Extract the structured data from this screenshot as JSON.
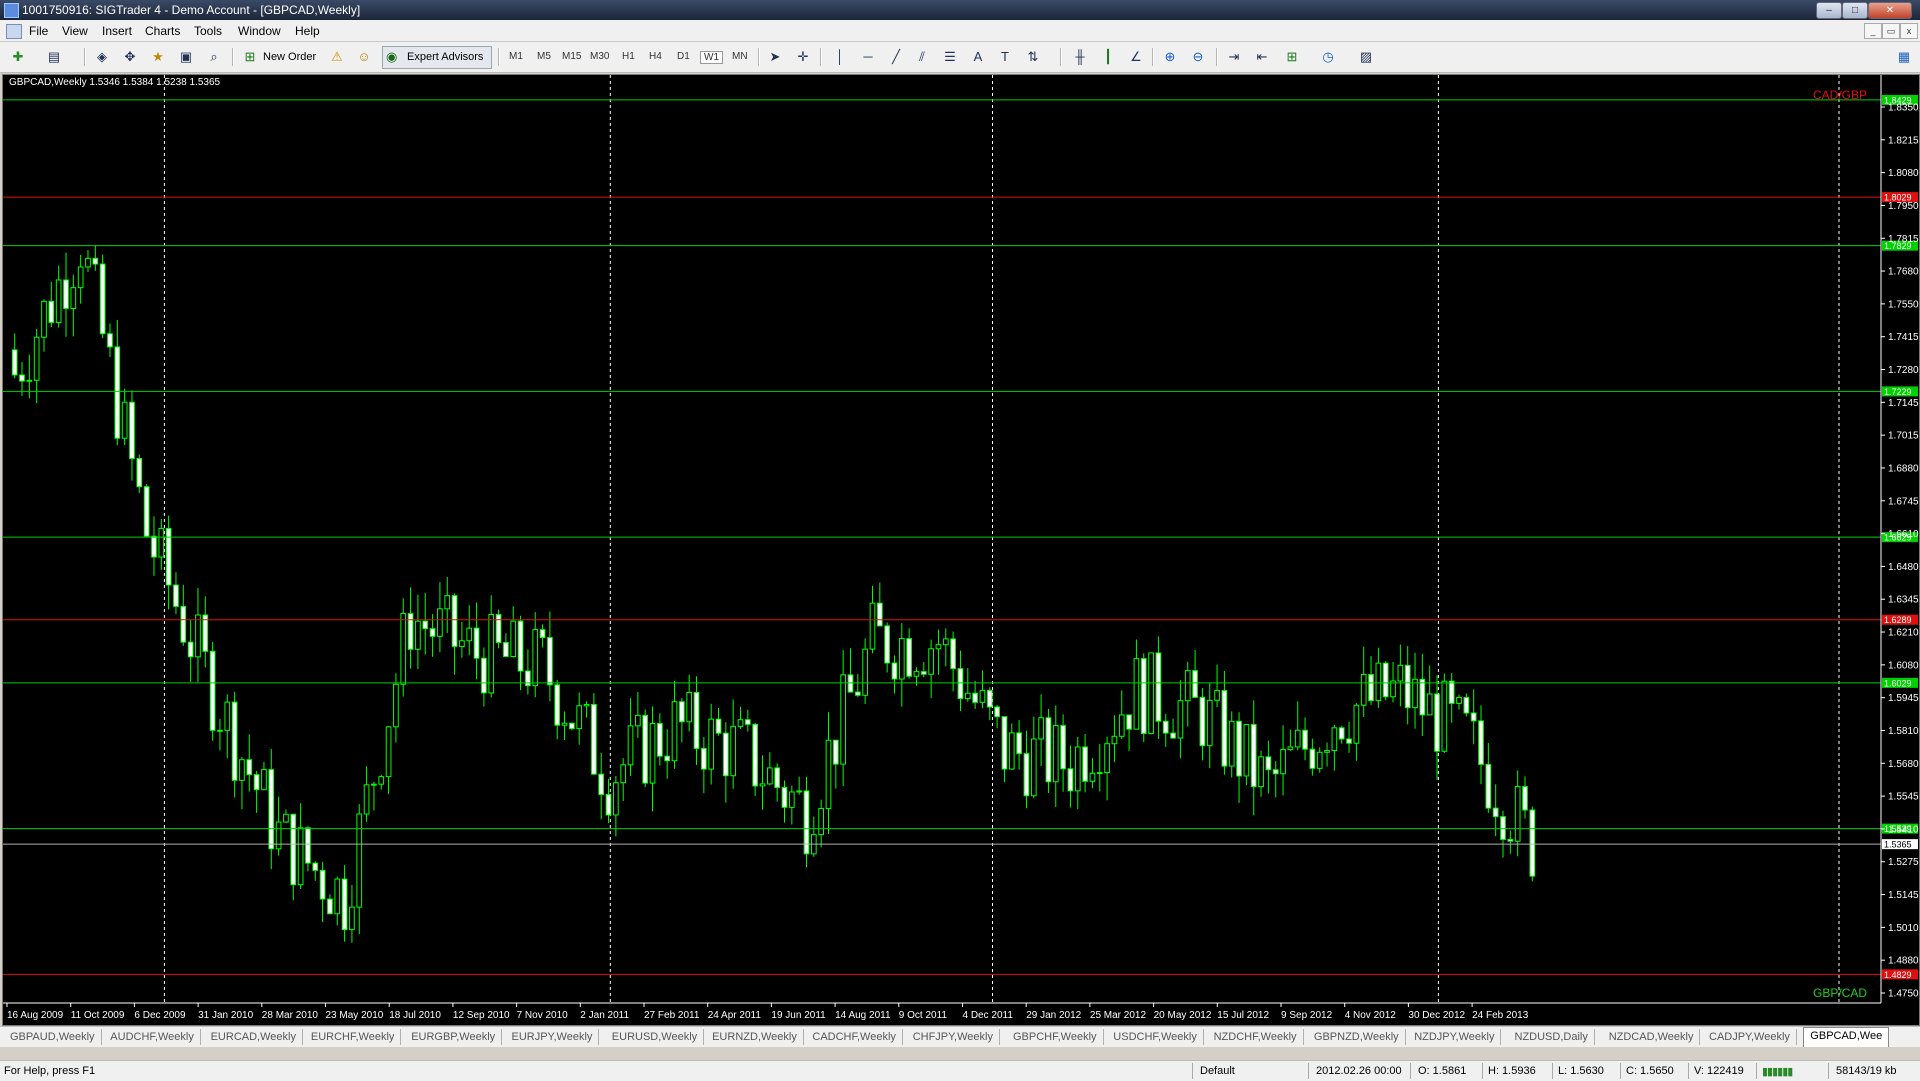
{
  "window": {
    "title": "1001750916: SIGTrader 4 - Demo Account - [GBPCAD,Weekly]",
    "min": "–",
    "max": "□",
    "close": "✕"
  },
  "menu": [
    "File",
    "View",
    "Insert",
    "Charts",
    "Tools",
    "Window",
    "Help"
  ],
  "toolbar": {
    "new_order": "New Order",
    "expert_advisors": "Expert Advisors",
    "timeframes": [
      "M1",
      "M5",
      "M15",
      "M30",
      "H1",
      "H4",
      "D1",
      "W1",
      "MN"
    ],
    "active_timeframe": "W1"
  },
  "chart": {
    "info": "GBPCAD,Weekly  1.5346 1.5384 1.5238 1.5365",
    "top_label": "CAD/GBP",
    "bottom_label": "GBP/CAD",
    "colors": {
      "background": "#000000",
      "candle": "#00ff00",
      "support": "#00d000",
      "resistance": "#e01010",
      "grid": "#ffffff"
    }
  },
  "chart_data": {
    "type": "candlestick",
    "symbol": "GBPCAD",
    "timeframe": "Weekly",
    "ylim": [
      1.4711,
      1.8474
    ],
    "y_ticks": [
      "1.8350",
      "1.8215",
      "1.8080",
      "1.7950",
      "1.7815",
      "1.7680",
      "1.7550",
      "1.7415",
      "1.7280",
      "1.7145",
      "1.7015",
      "1.6880",
      "1.6745",
      "1.6610",
      "1.6480",
      "1.6345",
      "1.6210",
      "1.6080",
      "1.5945",
      "1.5810",
      "1.5680",
      "1.5545",
      "1.5410",
      "1.5275",
      "1.5145",
      "1.5010",
      "1.4880",
      "1.4750"
    ],
    "x_ticks": [
      "16 Aug 2009",
      "11 Oct 2009",
      "6 Dec 2009",
      "31 Jan 2010",
      "28 Mar 2010",
      "23 May 2010",
      "18 Jul 2010",
      "12 Sep 2010",
      "7 Nov 2010",
      "2 Jan 2011",
      "27 Feb 2011",
      "24 Apr 2011",
      "19 Jun 2011",
      "14 Aug 2011",
      "9 Oct 2011",
      "4 Dec 2011",
      "29 Jan 2012",
      "25 Mar 2012",
      "20 May 2012",
      "15 Jul 2012",
      "9 Sep 2012",
      "4 Nov 2012",
      "30 Dec 2012",
      "24 Feb 2013"
    ],
    "levels": [
      {
        "price": 1.8429,
        "label": "1.8429",
        "kind": "support"
      },
      {
        "price": 1.8029,
        "label": "1.8029",
        "kind": "resistance"
      },
      {
        "price": 1.7829,
        "label": "1.7829",
        "kind": "support"
      },
      {
        "price": 1.7229,
        "label": "1.7229",
        "kind": "support"
      },
      {
        "price": 1.6629,
        "label": "1.6629",
        "kind": "support"
      },
      {
        "price": 1.6289,
        "label": "1.6289",
        "kind": "resistance"
      },
      {
        "price": 1.6029,
        "label": "1.6029",
        "kind": "support"
      },
      {
        "price": 1.5429,
        "label": "1.5429",
        "kind": "support"
      },
      {
        "price": 1.4829,
        "label": "1.4829",
        "kind": "resistance"
      }
    ],
    "current_price": {
      "price": 1.5365,
      "label": "1.5365"
    },
    "separators": [
      "6 Dec 2009",
      "2 Jan 2011",
      "4 Dec 2011",
      "30 Dec 2012"
    ],
    "candle_close_waypoints": [
      [
        "16 Aug 2009",
        1.73
      ],
      [
        "11 Oct 2009",
        1.785
      ],
      [
        "6 Dec 2009",
        1.665
      ],
      [
        "31 Jan 2010",
        1.6
      ],
      [
        "28 Mar 2010",
        1.54
      ],
      [
        "23 May 2010",
        1.515
      ],
      [
        "18 Jul 2010",
        1.63
      ],
      [
        "12 Sep 2010",
        1.615
      ],
      [
        "7 Nov 2010",
        1.61
      ],
      [
        "2 Jan 2011",
        1.565
      ],
      [
        "27 Feb 2011",
        1.585
      ],
      [
        "24 Apr 2011",
        1.575
      ],
      [
        "19 Jun 2011",
        1.55
      ],
      [
        "14 Aug 2011",
        1.62
      ],
      [
        "9 Oct 2011",
        1.62
      ],
      [
        "4 Dec 2011",
        1.575
      ],
      [
        "29 Jan 2012",
        1.57
      ],
      [
        "25 Mar 2012",
        1.6
      ],
      [
        "20 May 2012",
        1.59
      ],
      [
        "15 Jul 2012",
        1.56
      ],
      [
        "9 Sep 2012",
        1.59
      ],
      [
        "4 Nov 2012",
        1.6
      ],
      [
        "30 Dec 2012",
        1.58
      ],
      [
        "24 Feb 2013",
        1.5365
      ]
    ]
  },
  "tabs": [
    "GBPAUD,Weekly",
    "AUDCHF,Weekly",
    "EURCAD,Weekly",
    "EURCHF,Weekly",
    "EURGBP,Weekly",
    "EURJPY,Weekly",
    "EURUSD,Weekly",
    "EURNZD,Weekly",
    "CADCHF,Weekly",
    "CHFJPY,Weekly",
    "GBPCHF,Weekly",
    "USDCHF,Weekly",
    "NZDCHF,Weekly",
    "GBPNZD,Weekly",
    "NZDJPY,Weekly",
    "NZDUSD,Daily",
    "NZDCAD,Weekly",
    "CADJPY,Weekly",
    "GBPCAD,Wee"
  ],
  "active_tab": "GBPCAD,Wee",
  "status": {
    "help": "For Help, press F1",
    "profile": "Default",
    "datetime": "2012.02.26 00:00",
    "open": "O: 1.5861",
    "high": "H: 1.5936",
    "low": "L: 1.5630",
    "close": "C: 1.5650",
    "volume": "V: 122419",
    "traffic": "58143/19 kb"
  }
}
